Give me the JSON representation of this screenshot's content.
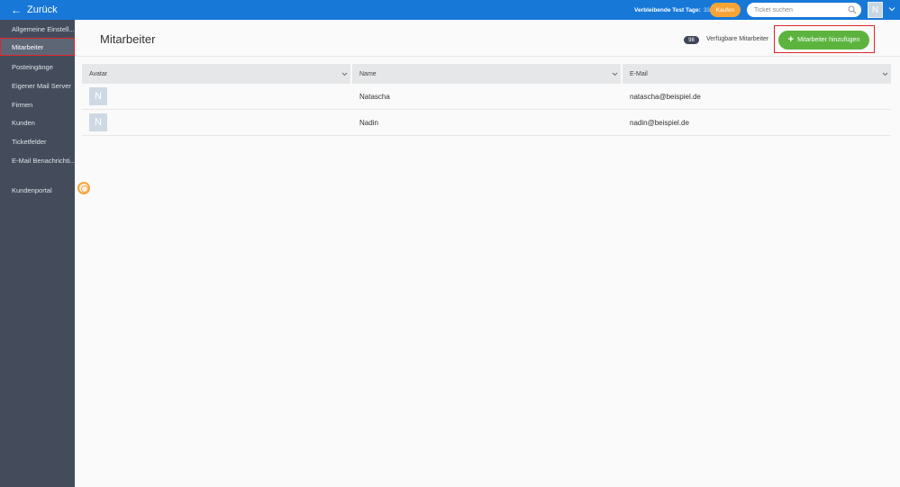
{
  "topbar": {
    "back_label": "Zurück",
    "trial_label": "Verbleibende Test Tage:",
    "trial_days": "3313",
    "buy_label": "Kaufen",
    "search_placeholder": "Ticket suchen",
    "user_initial": "N"
  },
  "sidebar": {
    "items": [
      {
        "label": "Allgemeine Einstell..."
      },
      {
        "label": "Mitarbeiter"
      },
      {
        "label": "Posteingänge"
      },
      {
        "label": "Eigener Mail Server"
      },
      {
        "label": "Firmen"
      },
      {
        "label": "Kunden"
      },
      {
        "label": "Ticketfelder"
      },
      {
        "label": "E-Mail Benachrichti..."
      },
      {
        "label": "Kundenportal"
      }
    ]
  },
  "main": {
    "title": "Mitarbeiter",
    "available_count": "98",
    "available_label": "Verfügbare Mitarbeiter",
    "add_button_label": "Mitarbeiter hinzufügen"
  },
  "table": {
    "columns": [
      "Avatar",
      "Name",
      "E-Mail"
    ],
    "rows": [
      {
        "initial": "N",
        "name": "Natascha",
        "email": "natascha@beispiel.de"
      },
      {
        "initial": "N",
        "name": "Nadin",
        "email": "nadin@beispiel.de"
      }
    ]
  },
  "colors": {
    "topbar": "#1778d8",
    "sidebar": "#444c5c",
    "buy_button": "#f7a437",
    "add_button": "#5cb43f",
    "highlight_frame": "#e0262b"
  }
}
